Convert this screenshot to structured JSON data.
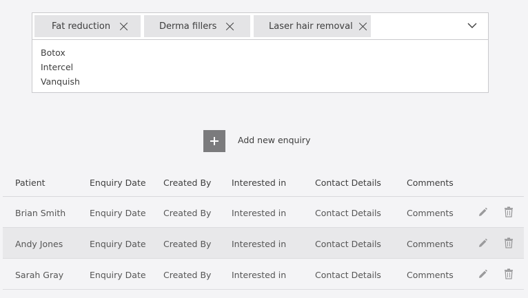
{
  "multiselect": {
    "chips": [
      {
        "label": "Fat reduction"
      },
      {
        "label": "Derma fillers"
      },
      {
        "label": "Laser hair removal"
      }
    ],
    "options": [
      "Botox",
      "Intercel",
      "Vanquish"
    ]
  },
  "actions": {
    "add_label": "Add new enquiry"
  },
  "table": {
    "columns": [
      "Patient",
      "Enquiry Date",
      "Created By",
      "Interested in",
      "Contact Details",
      "Comments"
    ],
    "rows": [
      [
        "Brian Smith",
        "Enquiry Date",
        "Created By",
        "Interested in",
        "Contact Details",
        "Comments"
      ],
      [
        "Andy Jones",
        "Enquiry Date",
        "Created By",
        "Interested in",
        "Contact Details",
        "Comments"
      ],
      [
        "Sarah Gray",
        "Enquiry Date",
        "Created By",
        "Interested in",
        "Contact Details",
        "Comments"
      ]
    ]
  },
  "colors": {
    "background": "#f4f4f6",
    "chip": "#e4e4e6",
    "add_button": "#7b7b7d",
    "alt_row": "#e8e8ea"
  },
  "icons": [
    "close-icon",
    "chevron-down-icon",
    "plus-icon",
    "pencil-icon",
    "trash-icon"
  ]
}
